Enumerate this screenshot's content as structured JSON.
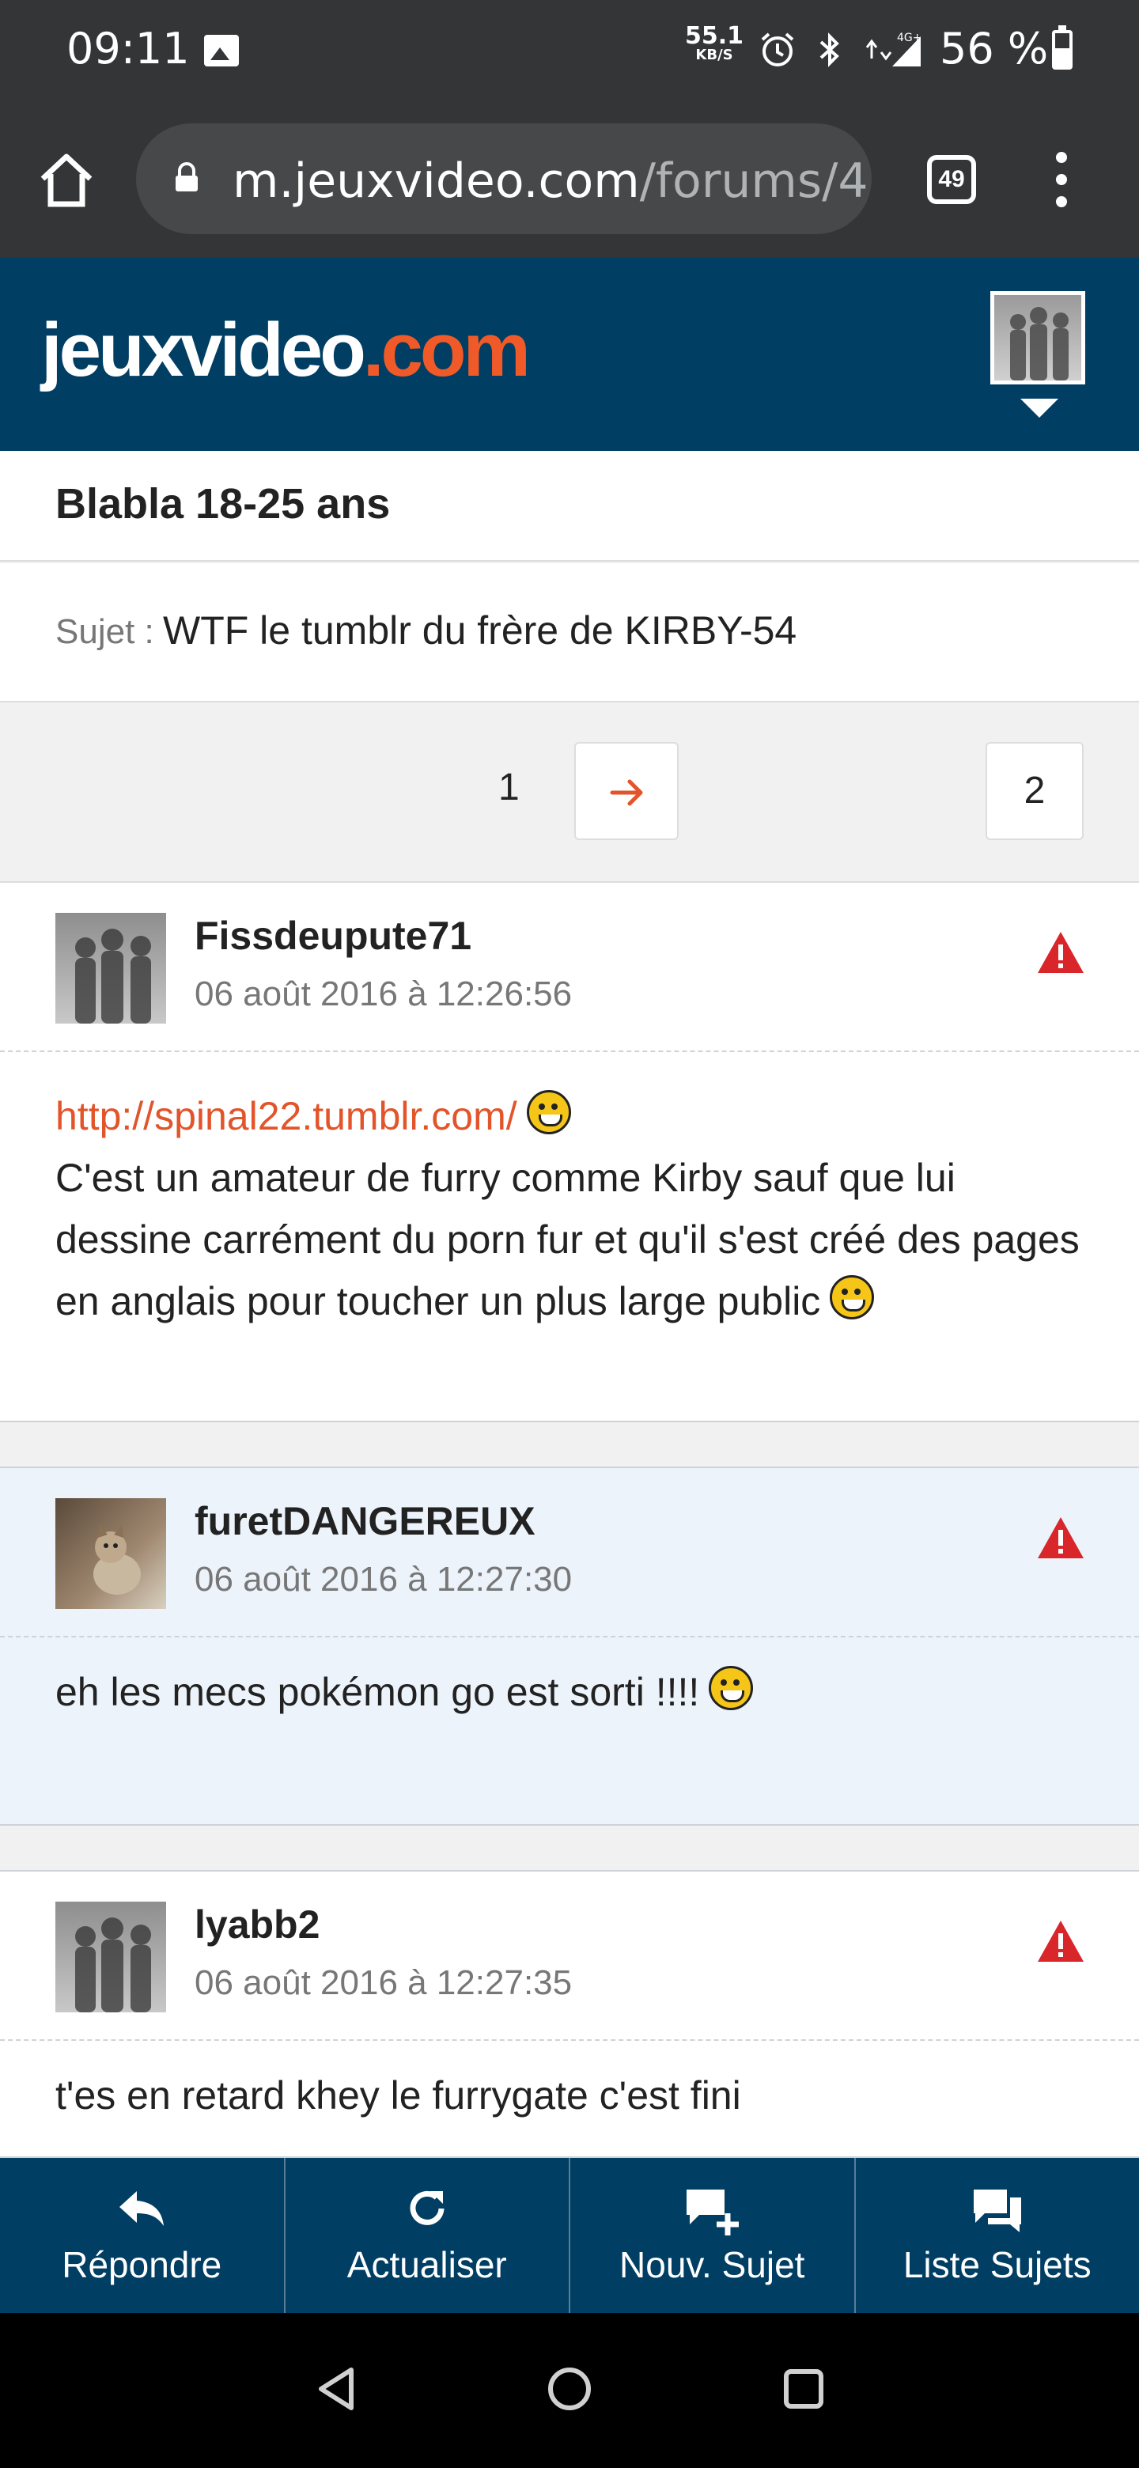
{
  "status_bar": {
    "time": "09:11",
    "speed_value": "55.1",
    "speed_unit": "KB/S",
    "network": "4G+",
    "battery": "56 %"
  },
  "browser": {
    "url_host": "m.jeuxvideo.com",
    "url_path": "/forums/4",
    "tab_count": "49"
  },
  "site": {
    "logo_main": "jeuxvideo",
    "logo_suffix": ".com",
    "brand_color": "#003e63",
    "accent_color": "#f05a28"
  },
  "forum": {
    "title": "Blabla 18-25 ans",
    "subject_label": "Sujet :",
    "subject_value": "WTF le tumblr du frère de KIRBY-54"
  },
  "pagination": {
    "current": "1",
    "last": "2"
  },
  "posts": [
    {
      "author": "Fissdeupute71",
      "date": "06 août 2016 à 12:26:56",
      "link": "http://spinal22.tumblr.com/",
      "text": "C'est un amateur de furry comme Kirby sauf que lui dessine carrément du porn fur et qu'il s'est créé des pages en anglais pour toucher un plus large public"
    },
    {
      "author": "furetDANGEREUX",
      "date": "06 août 2016 à 12:27:30",
      "text": "eh les mecs pokémon go est sorti !!!!"
    },
    {
      "author": "lyabb2",
      "date": "06 août 2016 à 12:27:35",
      "text": "t'es en retard khey le furrygate c'est fini"
    }
  ],
  "actions": [
    {
      "label": "Répondre",
      "icon": "reply-icon"
    },
    {
      "label": "Actualiser",
      "icon": "refresh-icon"
    },
    {
      "label": "Nouv. Sujet",
      "icon": "new-topic-icon"
    },
    {
      "label": "Liste Sujets",
      "icon": "topic-list-icon"
    }
  ]
}
